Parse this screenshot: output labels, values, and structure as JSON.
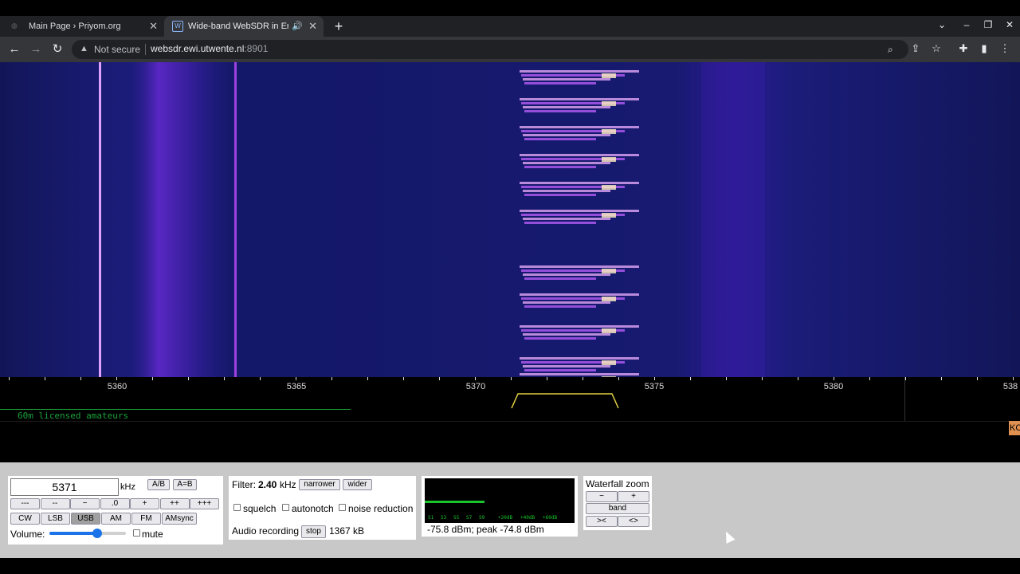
{
  "browser": {
    "tabs": [
      {
        "title": "Main Page › Priyom.org"
      },
      {
        "title": "Wide-band WebSDR in Enschede"
      }
    ],
    "omnibox": {
      "security": "Not secure",
      "host": "websdr.ewi.utwente.nl",
      "port": ":8901"
    },
    "icons": [
      "back-icon",
      "forward-icon",
      "reload-icon",
      "warning-icon",
      "zoom-icon",
      "share-icon",
      "star-icon",
      "extensions-icon",
      "sidepanel-icon",
      "menu-icon"
    ]
  },
  "spectrum": {
    "scale_labels": [
      "5360",
      "5365",
      "5370",
      "5375",
      "5380",
      "538"
    ],
    "band_label": "60m licensed amateurs",
    "marker_label": "KC"
  },
  "frequency": {
    "value": "5371",
    "unit": "kHz",
    "ab_label": "A/B",
    "aeqb_label": "A=B",
    "step_buttons": [
      "---",
      "--",
      "−",
      ".0",
      "+",
      "++",
      "+++"
    ]
  },
  "modes": {
    "buttons": [
      "CW",
      "LSB",
      "USB",
      "AM",
      "FM",
      "AMsync"
    ],
    "selected": "USB"
  },
  "volume": {
    "label": "Volume:",
    "level": 0.63,
    "mute_label": "mute"
  },
  "filter": {
    "label": "Filter:",
    "value": "2.40",
    "unit": "kHz",
    "narrower_label": "narrower",
    "wider_label": "wider",
    "squelch_label": "squelch",
    "autonotch_label": "autonotch",
    "noise_label": "noise reduction"
  },
  "recording": {
    "label": "Audio recording",
    "stop_label": "stop",
    "size": "1367 kB"
  },
  "smeter": {
    "level": 0.4,
    "readout": "-75.8 dBm; peak  -74.8 dBm",
    "marks": [
      "S1",
      "S3",
      "S5",
      "S7",
      "S9",
      "+20dB",
      "+40dB",
      "+60dB"
    ]
  },
  "zoom": {
    "title": "Waterfall zoom",
    "minus_label": "−",
    "plus_label": "+",
    "band_label": "band",
    "in_label": "><",
    "out_label": "<>"
  },
  "colors": {
    "waterfall_bg": "#141868",
    "signal": "#a040ff",
    "meter": "#19c52a",
    "band_label": "#1aa03a"
  }
}
